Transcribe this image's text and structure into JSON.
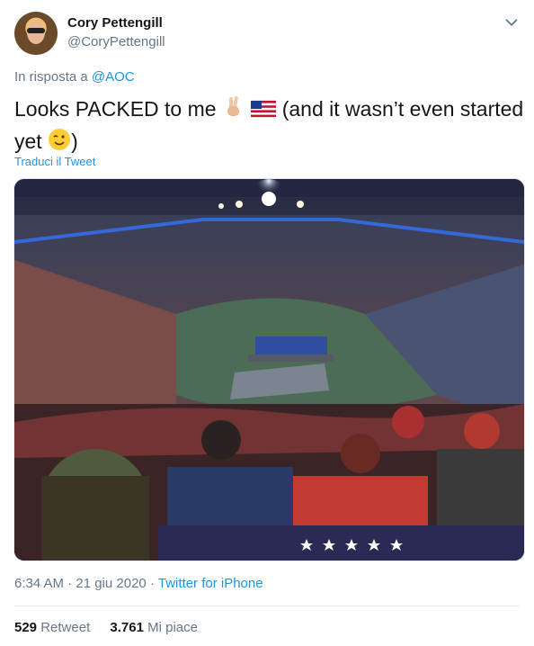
{
  "author": {
    "name": "Cory Pettengill",
    "handle": "@CoryPettengill"
  },
  "reply": {
    "prefix": "In risposta a",
    "to": "@AOC"
  },
  "tweet": {
    "line1": "Looks PACKED to me",
    "line1_rest": "(and it wasn’t even started",
    "line2": "yet",
    "line2_rest": ")",
    "translate": "Traduci il Tweet"
  },
  "meta": {
    "time": "6:34 AM · 21 giu 2020",
    "sep": "·",
    "source": "Twitter for iPhone"
  },
  "stats": {
    "retweets_count": "529",
    "retweets_label": "Retweet",
    "likes_count": "3.761",
    "likes_label": "Mi piace"
  },
  "icons": {
    "caret": "chevron-down-icon",
    "victory": "victory-hand-icon",
    "flag": "us-flag-icon",
    "wink": "winking-face-icon"
  }
}
